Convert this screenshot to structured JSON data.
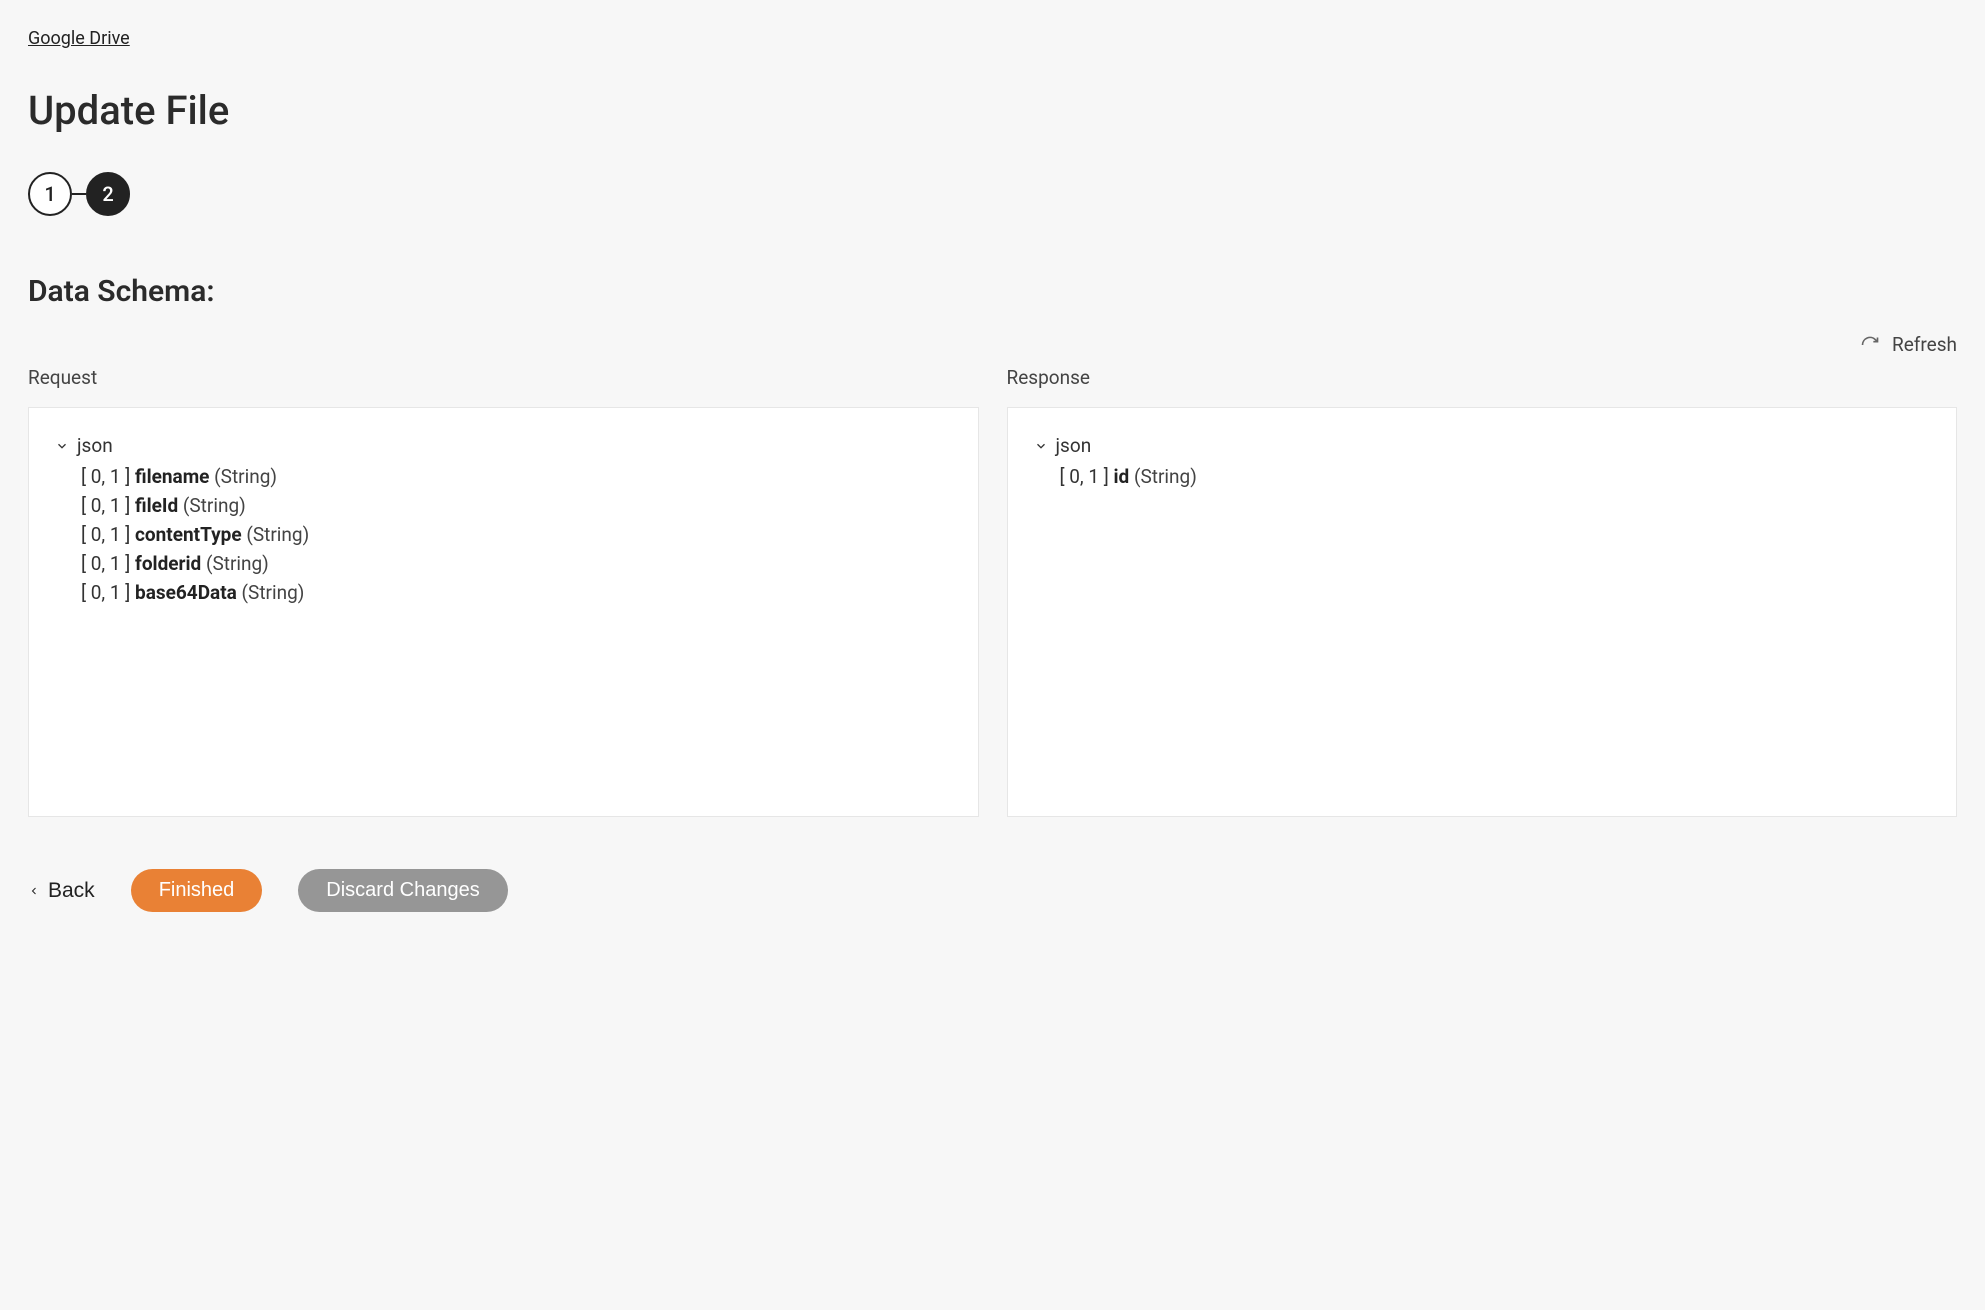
{
  "breadcrumb": {
    "label": "Google Drive"
  },
  "page_title": "Update File",
  "stepper": {
    "steps": [
      {
        "label": "1",
        "active": false
      },
      {
        "label": "2",
        "active": true
      }
    ]
  },
  "section_title": "Data Schema:",
  "refresh": {
    "label": "Refresh"
  },
  "panels": {
    "request": {
      "label": "Request",
      "root": "json",
      "fields": [
        {
          "cardinality": "[ 0, 1 ]",
          "name": "filename",
          "type": "(String)"
        },
        {
          "cardinality": "[ 0, 1 ]",
          "name": "fileId",
          "type": "(String)"
        },
        {
          "cardinality": "[ 0, 1 ]",
          "name": "contentType",
          "type": "(String)"
        },
        {
          "cardinality": "[ 0, 1 ]",
          "name": "folderid",
          "type": "(String)"
        },
        {
          "cardinality": "[ 0, 1 ]",
          "name": "base64Data",
          "type": "(String)"
        }
      ]
    },
    "response": {
      "label": "Response",
      "root": "json",
      "fields": [
        {
          "cardinality": "[ 0, 1 ]",
          "name": "id",
          "type": "(String)"
        }
      ]
    }
  },
  "footer": {
    "back_label": "Back",
    "finished_label": "Finished",
    "discard_label": "Discard Changes"
  }
}
